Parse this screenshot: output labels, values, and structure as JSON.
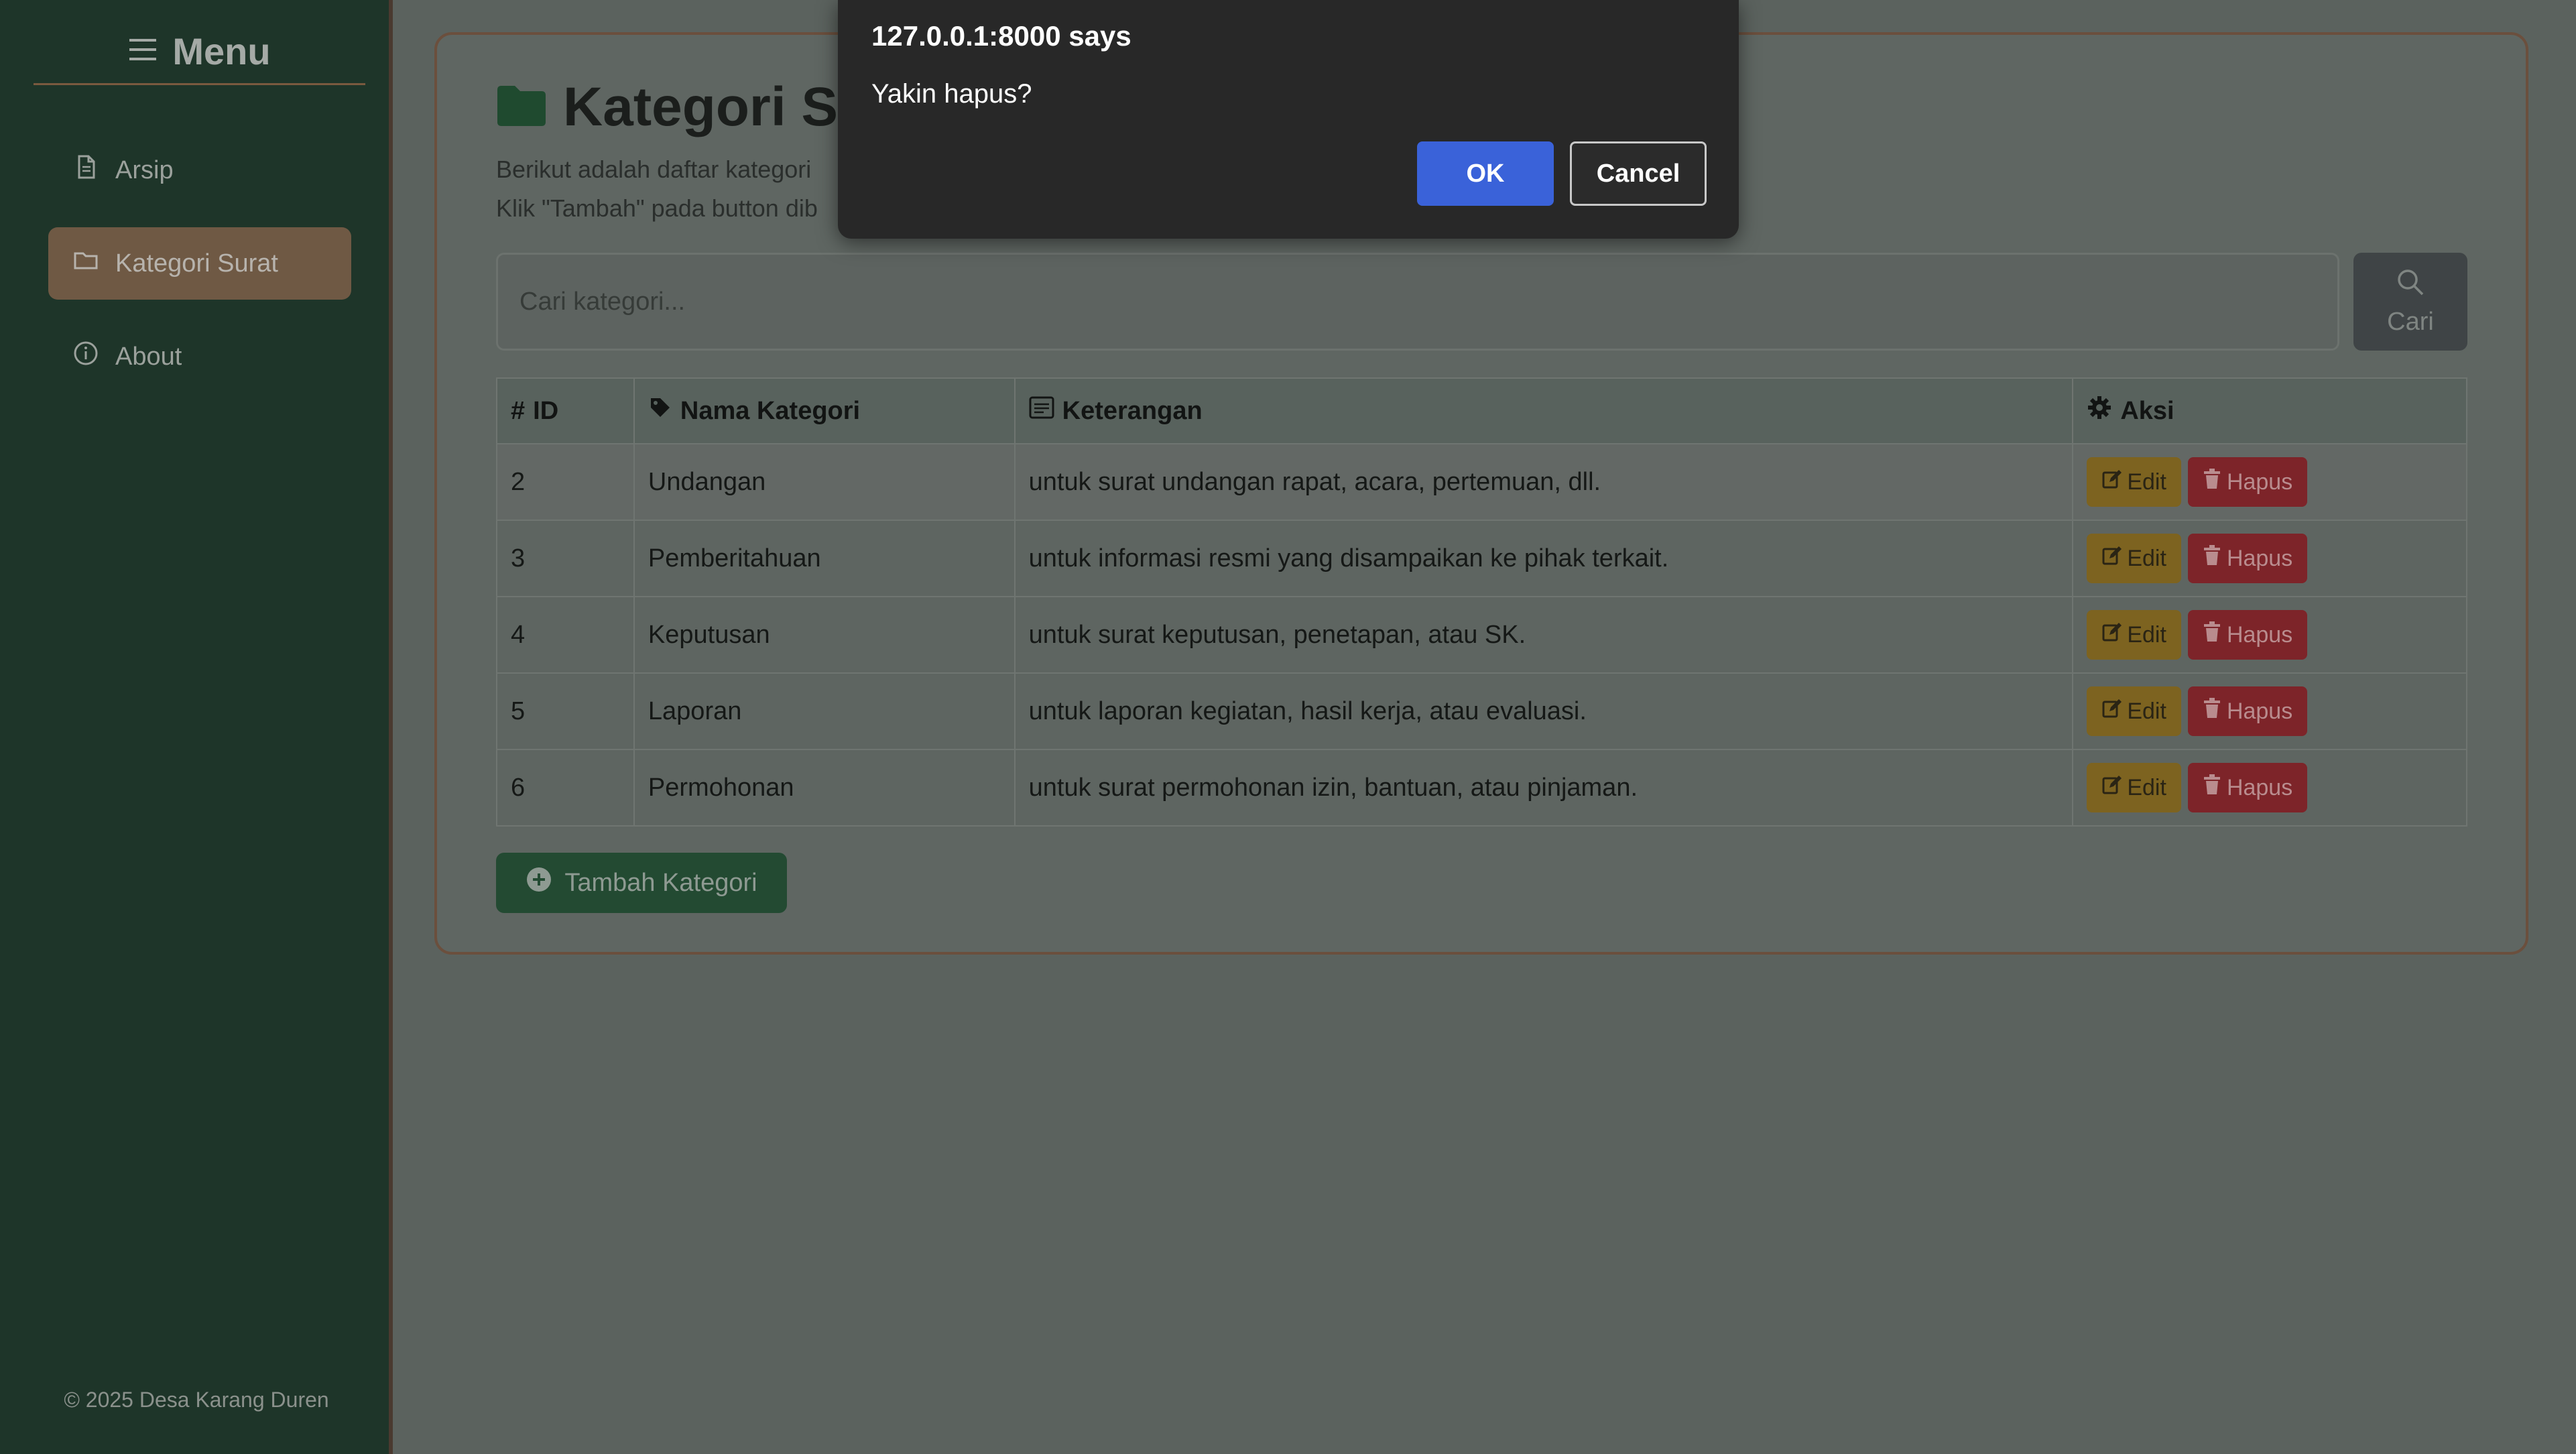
{
  "sidebar": {
    "title": "Menu",
    "items": [
      {
        "label": "Arsip",
        "icon": "file-icon"
      },
      {
        "label": "Kategori Surat",
        "icon": "folder-icon",
        "active": true
      },
      {
        "label": "About",
        "icon": "info-icon"
      }
    ],
    "footer": "© 2025 Desa Karang Duren"
  },
  "main": {
    "title": "Kategori Surat",
    "desc_line1": "Berikut adalah daftar kategori",
    "desc_line2": "Klik \"Tambah\" pada button dib",
    "search": {
      "placeholder": "Cari kategori...",
      "button": "Cari"
    },
    "table": {
      "headers": [
        "ID",
        "Nama Kategori",
        "Keterangan",
        "Aksi"
      ],
      "rows": [
        {
          "id": "2",
          "nama": "Undangan",
          "ket": "untuk surat undangan rapat, acara, pertemuan, dll."
        },
        {
          "id": "3",
          "nama": "Pemberitahuan",
          "ket": "untuk informasi resmi yang disampaikan ke pihak terkait."
        },
        {
          "id": "4",
          "nama": "Keputusan",
          "ket": "untuk surat keputusan, penetapan, atau SK."
        },
        {
          "id": "5",
          "nama": "Laporan",
          "ket": "untuk laporan kegiatan, hasil kerja, atau evaluasi."
        },
        {
          "id": "6",
          "nama": "Permohonan",
          "ket": "untuk surat permohonan izin, bantuan, atau pinjaman."
        }
      ],
      "edit_label": "Edit",
      "hapus_label": "Hapus",
      "id_prefix": "#"
    },
    "add_button": "Tambah Kategori"
  },
  "dialog": {
    "title": "127.0.0.1:8000 says",
    "message": "Yakin hapus?",
    "ok": "OK",
    "cancel": "Cancel"
  },
  "colors": {
    "sidebar_bg": "#1e3529",
    "active_item": "#6f5944",
    "ok_button": "#3a62d9",
    "edit_button": "#7d6320",
    "hapus_button": "#7d2429"
  }
}
